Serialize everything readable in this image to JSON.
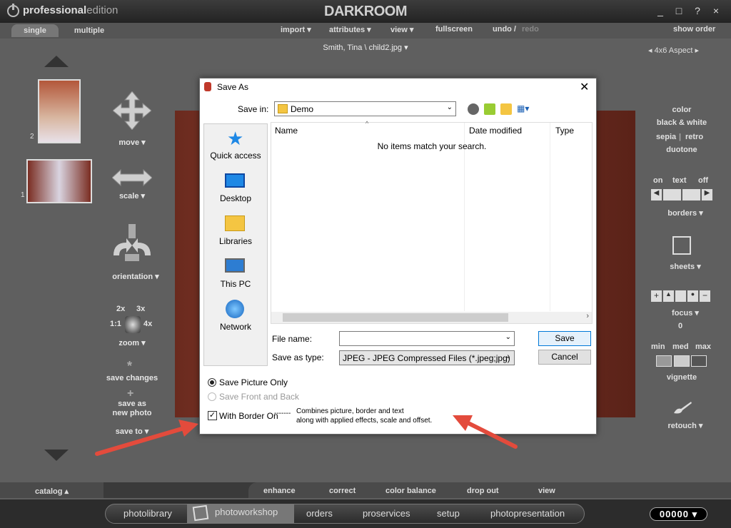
{
  "app": {
    "brand_strong": "professional",
    "brand_light": "edition",
    "logo": "DARKROOM",
    "window_controls": "_ □ ? ×"
  },
  "menubar": {
    "tabs": [
      "single",
      "multiple"
    ],
    "items": [
      "import ▾",
      "attributes ▾",
      "view ▾",
      "fullscreen",
      "undo /",
      "redo",
      "show order"
    ]
  },
  "subtitle": "Smith, Tina \\ child2.jpg ▾",
  "aspect": "◂  4x6  Aspect  ▸",
  "thumbnails": [
    "2",
    "1"
  ],
  "left_tools": {
    "move": "move ▾",
    "scale": "scale ▾",
    "orientation": "orientation ▾",
    "zoom_2x": "2x",
    "zoom_3x": "3x",
    "zoom_1x": "1:1",
    "zoom_4x": "4x",
    "zoom": "zoom ▾",
    "save_changes": "save changes",
    "save_as": "save as",
    "new_photo": "new photo",
    "save_to": "save to ▾"
  },
  "right_tools": {
    "color": "color",
    "bw": "black & white",
    "sepia": "sepia",
    "retro": "retro",
    "duotone": "duotone",
    "on": "on",
    "text": "text",
    "off": "off",
    "borders": "borders ▾",
    "sheets": "sheets ▾",
    "focus": "focus ▾",
    "focus_value": "0",
    "min": "min",
    "med": "med",
    "max": "max",
    "vignette": "vignette",
    "retouch": "retouch ▾"
  },
  "dialog": {
    "title": "Save As",
    "save_in_label": "Save in:",
    "save_in_value": "Demo",
    "places": [
      "Quick access",
      "Desktop",
      "Libraries",
      "This PC",
      "Network"
    ],
    "columns": [
      "Name",
      "Date modified",
      "Type"
    ],
    "empty_message": "No items match your search.",
    "file_name_label": "File name:",
    "file_name_value": "",
    "save_as_type_label": "Save as type:",
    "save_as_type_value": "JPEG - JPEG Compressed Files (*.jpeg;jpg)",
    "save_button": "Save",
    "cancel_button": "Cancel",
    "radio_1": "Save Picture Only",
    "radio_2": "Save Front and Back",
    "checkbox": "With Border On",
    "checkbox_dashes": "-------",
    "help_line1": "Combines picture, border and text",
    "help_line2": "along with applied effects, scale and offset."
  },
  "bottom_tabs": {
    "catalog": "catalog ▴",
    "items": [
      "enhance",
      "correct",
      "color balance",
      "drop out",
      "view"
    ]
  },
  "footer_nav": [
    "photolibrary",
    "photoworkshop",
    "orders",
    "proservices",
    "setup",
    "photopresentation"
  ],
  "counter": "00000 ▾",
  "colors": {
    "accent": "#e34b3c",
    "dialog_select": "#0078d7"
  }
}
